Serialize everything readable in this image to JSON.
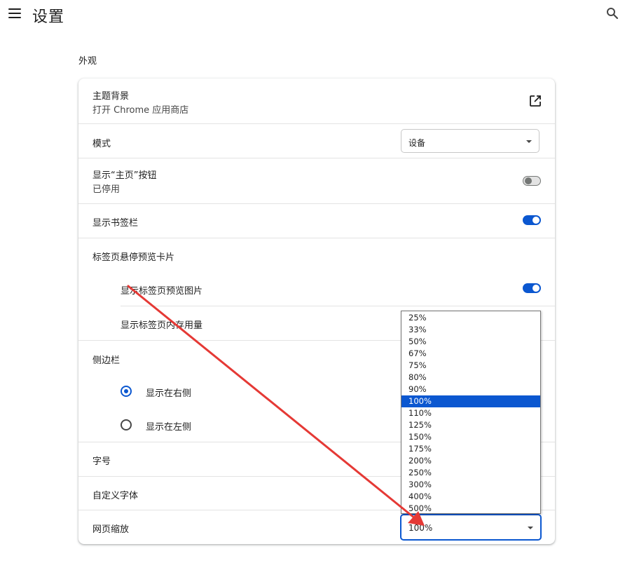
{
  "header": {
    "title": "设置",
    "menu_icon": "menu-icon",
    "search_icon": "search-icon"
  },
  "appearance": {
    "section_title": "外观",
    "theme": {
      "label": "主题背景",
      "sublabel": "打开 Chrome 应用商店",
      "icon": "open-in-new-icon"
    },
    "mode": {
      "label": "模式",
      "value": "设备"
    },
    "home_button": {
      "label": "显示“主页”按钮",
      "sublabel": "已停用",
      "enabled": false
    },
    "bookmarks_bar": {
      "label": "显示书签栏",
      "enabled": true
    },
    "tab_hover": {
      "label": "标签页悬停预览卡片",
      "preview_image": {
        "label": "显示标签页预览图片",
        "enabled": true
      },
      "memory_usage": {
        "label": "显示标签页内存用量"
      }
    },
    "side_panel": {
      "label": "侧边栏",
      "options": [
        {
          "label": "显示在右侧",
          "checked": true
        },
        {
          "label": "显示在左侧",
          "checked": false
        }
      ]
    },
    "font_size": {
      "label": "字号"
    },
    "custom_fonts": {
      "label": "自定义字体"
    },
    "page_zoom": {
      "label": "网页缩放",
      "value": "100%",
      "options": [
        "25%",
        "33%",
        "50%",
        "67%",
        "75%",
        "80%",
        "90%",
        "100%",
        "110%",
        "125%",
        "150%",
        "175%",
        "200%",
        "250%",
        "300%",
        "400%",
        "500%"
      ],
      "selected_index": 7
    }
  },
  "annotation": {
    "color": "#e53935"
  },
  "colors": {
    "accent": "#0b57d0",
    "text": "#1f1f1f"
  }
}
